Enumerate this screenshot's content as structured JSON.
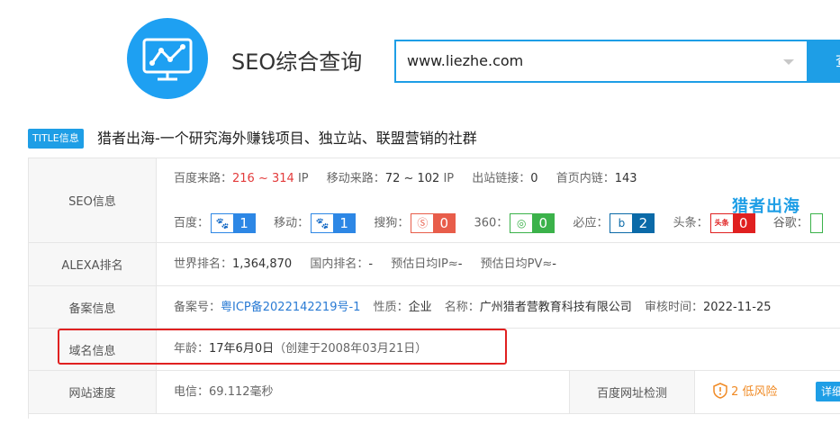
{
  "header": {
    "app_title": "SEO综合查询",
    "search_value": "www.liezhe.com",
    "search_button_label": "查"
  },
  "title_info": {
    "badge": "TITLE信息",
    "text": "猎者出海-一个研究海外赚钱项目、独立站、联盟营销的社群"
  },
  "seo": {
    "label": "SEO信息",
    "baidu_traffic_label": "百度来路：",
    "baidu_traffic_value": "216 ~ 314",
    "baidu_traffic_unit": "IP",
    "mobile_traffic_label": "移动来路：",
    "mobile_traffic_value": "72 ~ 102",
    "mobile_traffic_unit": "IP",
    "outbound_label": "出站链接：",
    "outbound_value": "0",
    "internal_label": "首页内链：",
    "internal_value": "143",
    "ranks": [
      {
        "label": "百度：",
        "value": "1",
        "icon": "paw-icon"
      },
      {
        "label": "移动：",
        "value": "1",
        "icon": "paw-icon"
      },
      {
        "label": "搜狗：",
        "value": "0",
        "icon": "sogou-icon"
      },
      {
        "label": "360：",
        "value": "0",
        "icon": "360-icon"
      },
      {
        "label": "必应：",
        "value": "2",
        "icon": "bing-icon"
      },
      {
        "label": "头条：",
        "value": "0",
        "icon": "toutiao-icon"
      },
      {
        "label": "谷歌：",
        "value": "",
        "icon": "google-icon"
      }
    ],
    "toutiao_icon_text": "头条"
  },
  "watermark": "猎者出海",
  "alexa": {
    "label": "ALEXA排名",
    "world_label": "世界排名：",
    "world_value": "1,364,870",
    "domestic_label": "国内排名：",
    "domestic_value": "-",
    "ip_label": "预估日均IP≈",
    "ip_value": "-",
    "pv_label": "预估日均PV≈",
    "pv_value": "-"
  },
  "icp": {
    "label": "备案信息",
    "number_label": "备案号：",
    "number_value": "粤ICP备2022142219号-1",
    "nature_label": "性质：",
    "nature_value": "企业",
    "name_label": "名称：",
    "name_value": "广州猎者营教育科技有限公司",
    "date_label": "审核时间：",
    "date_value": "2022-11-25"
  },
  "domain": {
    "label": "域名信息",
    "age_label": "年龄：",
    "age_value": "17年6月0日",
    "created_value": "（创建于2008年03月21日）"
  },
  "speed": {
    "label": "网站速度",
    "telecom_label": "电信：",
    "telecom_value": "69.112毫秒",
    "check_label": "百度网址检测",
    "risk_value": "2 低风险",
    "detail_label": "详细"
  },
  "colors": {
    "accent": "#1e9ee6",
    "highlight_box": "#e02020",
    "traffic_red": "#e33b3b",
    "risk_orange": "#f08a24"
  }
}
